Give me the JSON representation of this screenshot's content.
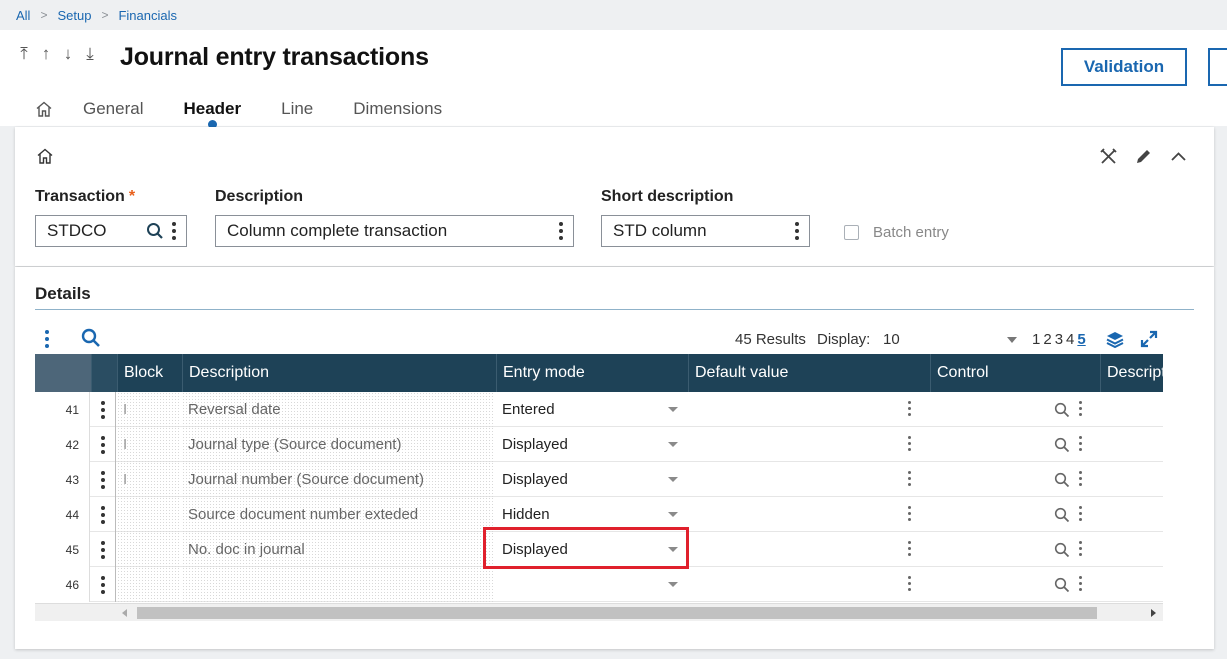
{
  "breadcrumb": [
    "All",
    "Setup",
    "Financials"
  ],
  "page_title": "Journal entry transactions",
  "buttons": {
    "validation": "Validation"
  },
  "tabs": [
    {
      "label": "General"
    },
    {
      "label": "Header"
    },
    {
      "label": "Line"
    },
    {
      "label": "Dimensions"
    }
  ],
  "active_tab": "Header",
  "header_form": {
    "transaction": {
      "label": "Transaction",
      "required_mark": "*",
      "value": "STDCO"
    },
    "description": {
      "label": "Description",
      "value": "Column complete transaction"
    },
    "short_description": {
      "label": "Short description",
      "value": "STD column"
    },
    "batch_entry": {
      "label": "Batch entry",
      "checked": false
    }
  },
  "details": {
    "title": "Details",
    "results_text": "45 Results",
    "display_label": "Display:",
    "display_value": "10",
    "pages": [
      "1",
      "2",
      "3",
      "4",
      "5"
    ],
    "current_page": "5",
    "columns": [
      "Block",
      "Description",
      "Entry mode",
      "Default value",
      "Control",
      "Descript"
    ],
    "rows": [
      {
        "num": "41",
        "block": "I",
        "description": "Reversal date",
        "entry_mode": "Entered"
      },
      {
        "num": "42",
        "block": "I",
        "description": "Journal type (Source document)",
        "entry_mode": "Displayed"
      },
      {
        "num": "43",
        "block": "I",
        "description": "Journal number (Source document)",
        "entry_mode": "Displayed"
      },
      {
        "num": "44",
        "block": "",
        "description": "Source document number exteded",
        "entry_mode": "Hidden"
      },
      {
        "num": "45",
        "block": "",
        "description": "No. doc in journal",
        "entry_mode": "Displayed"
      },
      {
        "num": "46",
        "block": "",
        "description": "",
        "entry_mode": ""
      }
    ]
  },
  "colors": {
    "accent": "#1a67b0",
    "grid_header": "#1e4257",
    "required": "#e8601c",
    "highlight": "#e0202c"
  }
}
